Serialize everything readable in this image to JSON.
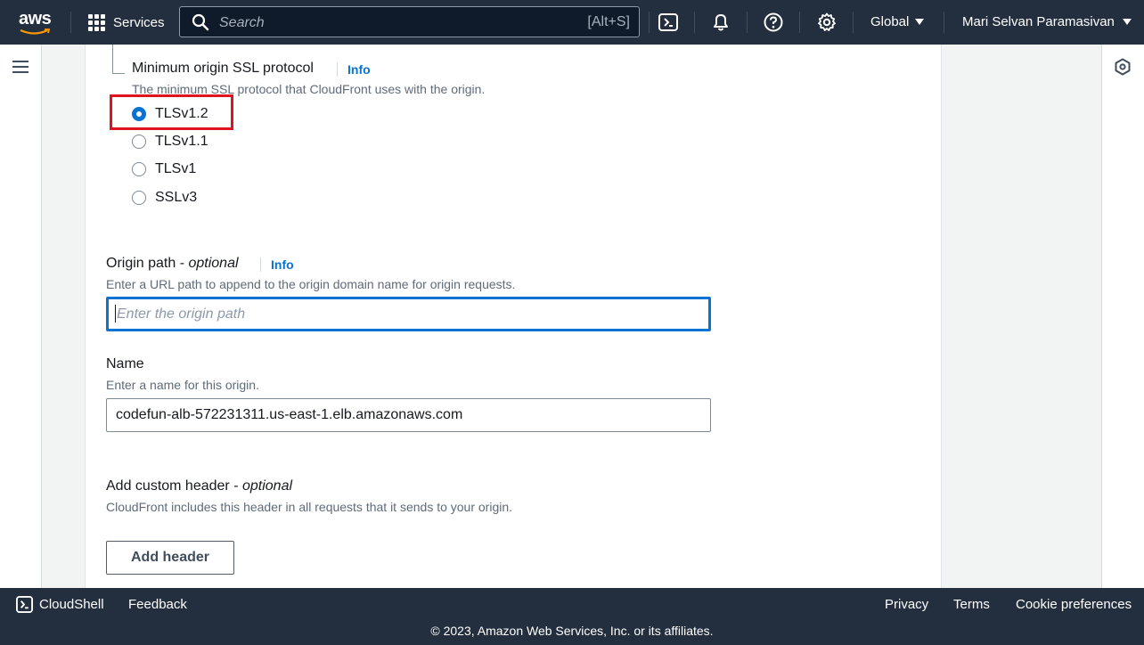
{
  "topnav": {
    "logo_text": "aws",
    "services_label": "Services",
    "search_placeholder": "Search",
    "search_shortcut": "[Alt+S]",
    "region_label": "Global",
    "user_name": "Mari Selvan Paramasivan",
    "icons": [
      "cloudshell-icon",
      "bell-icon",
      "help-icon",
      "settings-icon"
    ]
  },
  "form": {
    "ssl": {
      "label": "Minimum origin SSL protocol",
      "info": "Info",
      "description": "The minimum SSL protocol that CloudFront uses with the origin.",
      "options": [
        {
          "label": "TLSv1.2",
          "checked": true
        },
        {
          "label": "TLSv1.1",
          "checked": false
        },
        {
          "label": "TLSv1",
          "checked": false
        },
        {
          "label": "SSLv3",
          "checked": false
        }
      ]
    },
    "origin_path": {
      "label": "Origin path - ",
      "optional": "optional",
      "info": "Info",
      "description": "Enter a URL path to append to the origin domain name for origin requests.",
      "placeholder": "Enter the origin path",
      "value": ""
    },
    "name": {
      "label": "Name",
      "description": "Enter a name for this origin.",
      "value": "codefun-alb-572231311.us-east-1.elb.amazonaws.com"
    },
    "custom_header": {
      "label": "Add custom header - ",
      "optional": "optional",
      "description": "CloudFront includes this header in all requests that it sends to your origin.",
      "button": "Add header"
    }
  },
  "footer": {
    "cloudshell": "CloudShell",
    "feedback": "Feedback",
    "privacy": "Privacy",
    "terms": "Terms",
    "cookie": "Cookie preferences",
    "copyright": "© 2023, Amazon Web Services, Inc. or its affiliates."
  },
  "colors": {
    "nav_bg": "#232f3e",
    "accent": "#0972d3",
    "highlight": "#e0141e"
  }
}
